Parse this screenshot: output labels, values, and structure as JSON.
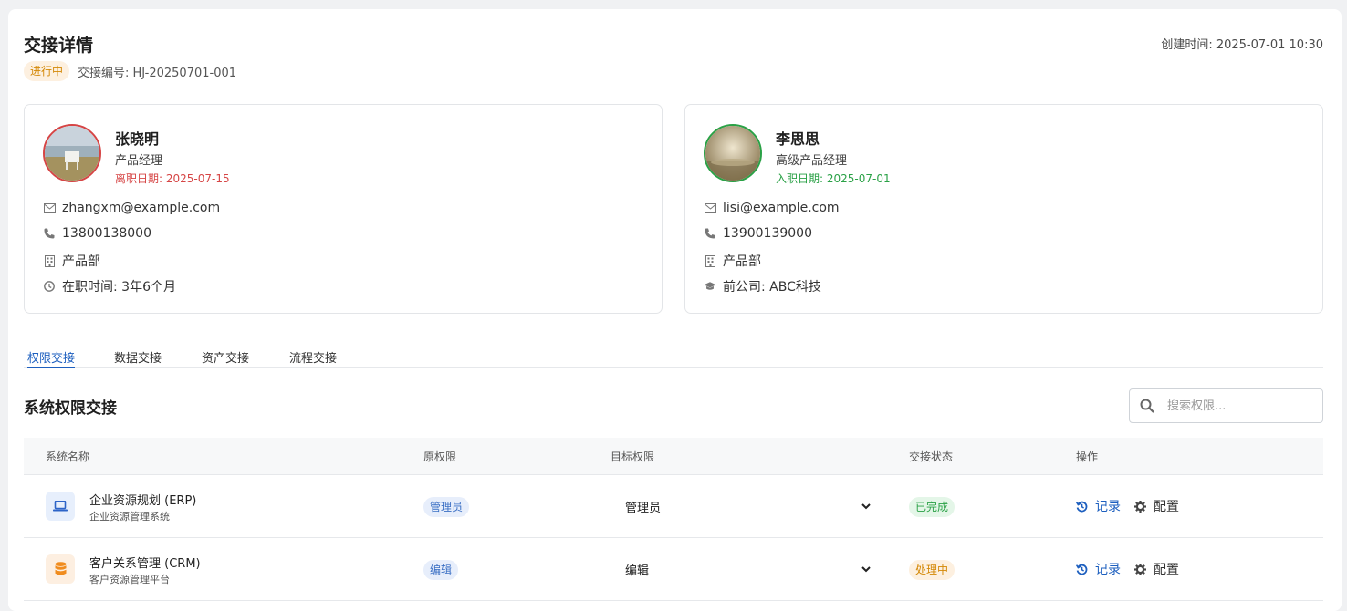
{
  "header": {
    "title": "交接详情",
    "created_label": "创建时间: 2025-07-01 10:30",
    "status": "进行中",
    "handover_no": "交接编号: HJ-20250701-001"
  },
  "from_person": {
    "name": "张晓明",
    "role": "产品经理",
    "date_label": "离职日期: 2025-07-15",
    "email": "zhangxm@example.com",
    "phone": "13800138000",
    "department": "产品部",
    "tenure": "在职时间: 3年6个月"
  },
  "to_person": {
    "name": "李思思",
    "role": "高级产品经理",
    "date_label": "入职日期: 2025-07-01",
    "email": "lisi@example.com",
    "phone": "13900139000",
    "department": "产品部",
    "previous_company": "前公司: ABC科技"
  },
  "tabs": [
    "权限交接",
    "数据交接",
    "资产交接",
    "流程交接"
  ],
  "section": {
    "title": "系统权限交接",
    "search_placeholder": "搜索权限..."
  },
  "table": {
    "headers": [
      "系统名称",
      "原权限",
      "目标权限",
      "交接状态",
      "操作"
    ],
    "rows": [
      {
        "system_name": "企业资源规划 (ERP)",
        "system_desc": "企业资源管理系统",
        "icon": "laptop-icon",
        "original_permission": "管理员",
        "target_permission": "管理员",
        "status": "已完成",
        "action_record": "记录",
        "action_config": "配置"
      },
      {
        "system_name": "客户关系管理 (CRM)",
        "system_desc": "客户资源管理平台",
        "icon": "database-icon",
        "original_permission": "编辑",
        "target_permission": "编辑",
        "status": "处理中",
        "action_record": "记录",
        "action_config": "配置"
      }
    ]
  },
  "colors": {
    "accent": "#1d5fbf",
    "danger": "#d64545",
    "success": "#2aa146",
    "warning": "#d48806"
  }
}
